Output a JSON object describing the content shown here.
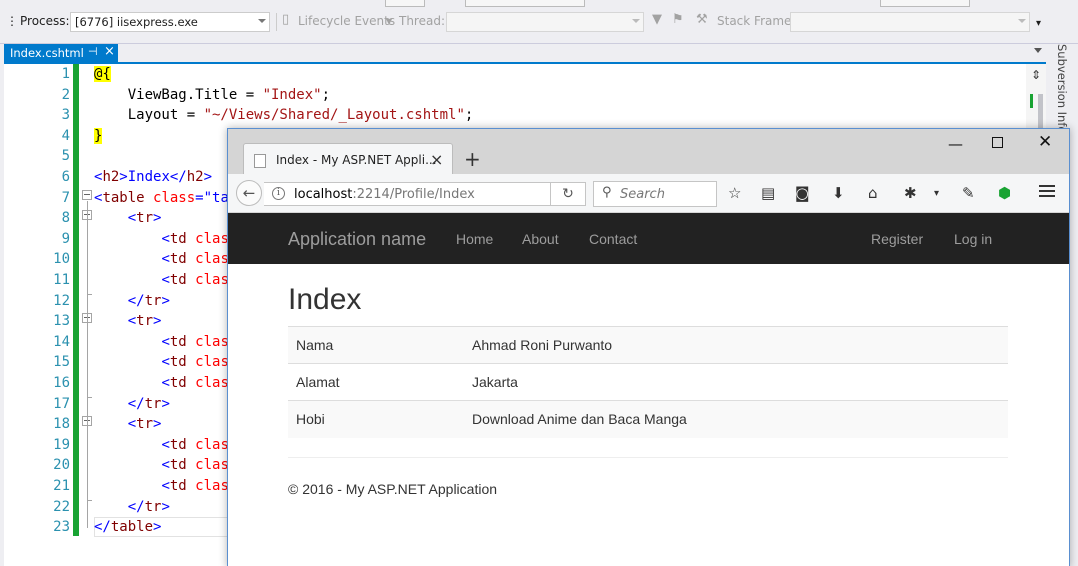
{
  "toolbar": {
    "process_label": "Process:",
    "process_value": "[6776] iisexpress.exe",
    "lifecycle_label": "Lifecycle Events",
    "thread_label": "Thread:",
    "stack_frame_label": "Stack Frame:"
  },
  "editor": {
    "tab_title": "Index.cshtml",
    "side_panel_title": "Subversion Info",
    "line_numbers": [
      "1",
      "2",
      "3",
      "4",
      "5",
      "6",
      "7",
      "8",
      "9",
      "10",
      "11",
      "12",
      "13",
      "14",
      "15",
      "16",
      "17",
      "18",
      "19",
      "20",
      "21",
      "22",
      "23"
    ],
    "code": {
      "l1": "@{",
      "l2a": "    ViewBag.Title = ",
      "l2b": "\"Index\"",
      "l2c": ";",
      "l3a": "    Layout = ",
      "l3b": "\"~/Views/Shared/_Layout.cshtml\"",
      "l3c": ";",
      "l4": "}",
      "l6a": "<",
      "l6b": "h2",
      "l6c": ">Index</",
      "l6d": "h2",
      "l6e": ">",
      "l7a": "<",
      "l7b": "table",
      "l7c": " class",
      "l7d": "=",
      "l7e": "\"ta",
      "tr_open": "tr",
      "tr_close": "tr",
      "td": "td",
      "cls": " clas",
      "l23": "table"
    }
  },
  "browser": {
    "tab_title": "Index - My ASP.NET Appli...",
    "url_host": "localhost",
    "url_path": ":2214/Profile/Index",
    "search_placeholder": "Search"
  },
  "page": {
    "brand": "Application name",
    "nav": {
      "home": "Home",
      "about": "About",
      "contact": "Contact",
      "register": "Register",
      "login": "Log in"
    },
    "title": "Index",
    "rows": [
      {
        "label": "Nama",
        "value": "Ahmad Roni Purwanto"
      },
      {
        "label": "Alamat",
        "value": "Jakarta"
      },
      {
        "label": "Hobi",
        "value": "Download Anime dan Baca Manga"
      }
    ],
    "footer": "© 2016 - My ASP.NET Application"
  },
  "colors": {
    "accent": "#007acc",
    "change_bar": "#19a333",
    "navbar": "#222222"
  }
}
